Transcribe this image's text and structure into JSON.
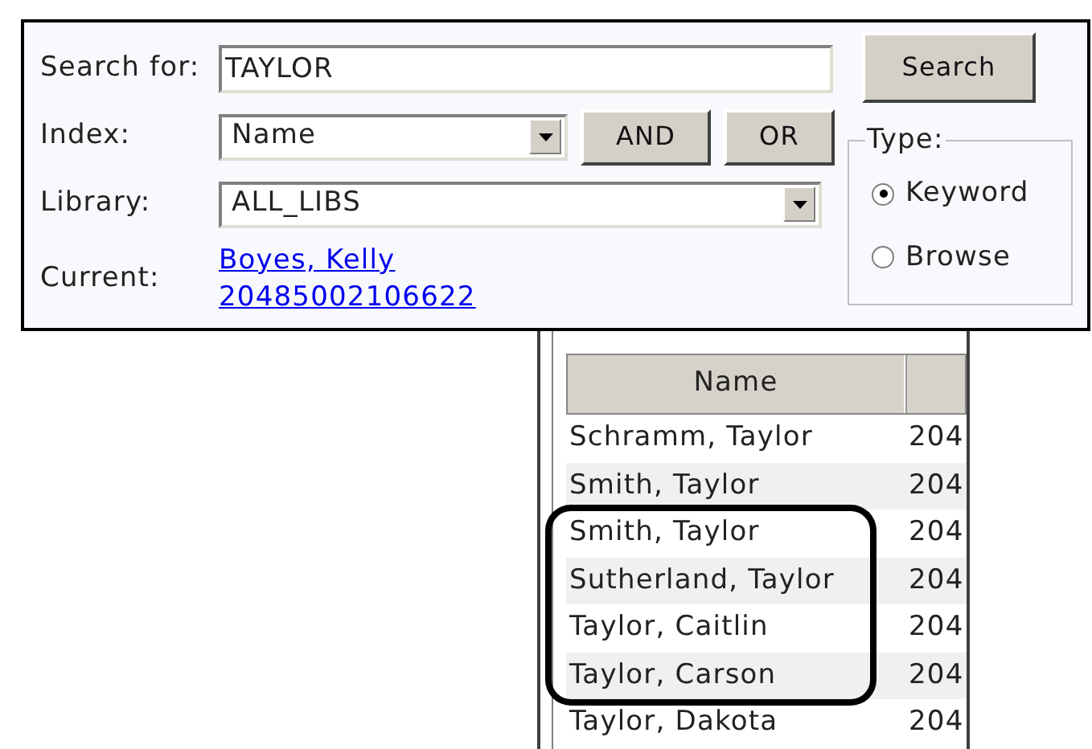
{
  "search": {
    "label": "Search for:",
    "value": "TAYLOR",
    "button": "Search"
  },
  "index": {
    "label": "Index:",
    "value": "Name"
  },
  "operators": [
    "AND",
    "OR"
  ],
  "library": {
    "label": "Library:",
    "value": "ALL_LIBS"
  },
  "current": {
    "label": "Current:",
    "links": [
      "Boyes, Kelly",
      "20485002106622"
    ]
  },
  "type": {
    "legend": "Type:",
    "options": [
      {
        "label": "Keyword",
        "selected": true
      },
      {
        "label": "Browse",
        "selected": false
      }
    ]
  },
  "table": {
    "columns": [
      "Name"
    ],
    "rows": [
      {
        "name": "Schramm, Taylor",
        "column_2": "204",
        "highlighted": false
      },
      {
        "name": "Smith, Taylor",
        "column_2": "204",
        "highlighted": false
      },
      {
        "name": "Smith, Taylor",
        "column_2": "204",
        "highlighted": true
      },
      {
        "name": "Sutherland, Taylor",
        "column_2": "204",
        "highlighted": true
      },
      {
        "name": "Taylor, Caitlin",
        "column_2": "204",
        "highlighted": true
      },
      {
        "name": "Taylor, Carson",
        "column_2": "204",
        "highlighted": true
      },
      {
        "name": "Taylor, Dakota",
        "column_2": "204",
        "highlighted": false
      }
    ]
  }
}
